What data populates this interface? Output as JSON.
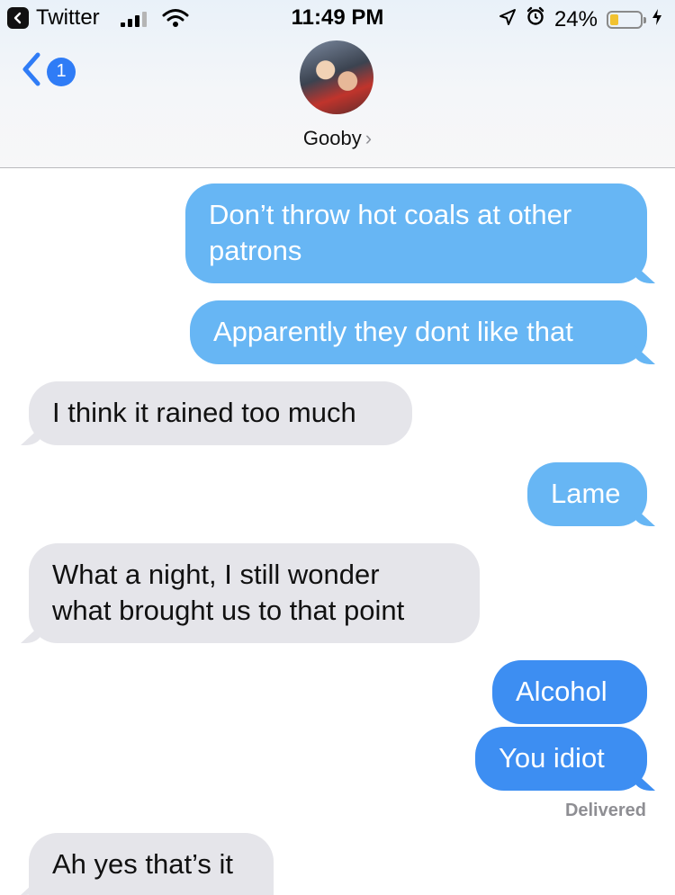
{
  "status_bar": {
    "back_app_label": "Twitter",
    "time": "11:49 PM",
    "battery_percent": "24%",
    "battery_level": 0.24,
    "battery_color": "#f2c230",
    "icons": [
      "signal-icon",
      "wifi-icon",
      "location-arrow-icon",
      "alarm-icon",
      "battery-icon",
      "charging-bolt-icon"
    ]
  },
  "header": {
    "back_badge_count": "1",
    "contact_name": "Gooby",
    "contact_chevron": "›"
  },
  "colors": {
    "sent_light": "#67b6f4",
    "sent_dark": "#3d8ef2",
    "received": "#e5e5ea",
    "accent": "#2f7cf6"
  },
  "messages": [
    {
      "direction": "sent",
      "text_lines": [
        "Don’t throw hot coals at other",
        "patrons"
      ]
    },
    {
      "direction": "sent",
      "text_lines": [
        "Apparently they dont like that"
      ]
    },
    {
      "direction": "received",
      "text_lines": [
        "I think it rained too much"
      ]
    },
    {
      "direction": "sent",
      "text_lines": [
        "Lame"
      ]
    },
    {
      "direction": "received",
      "text_lines": [
        "What a night, I still wonder",
        "what brought us to that point"
      ]
    },
    {
      "direction": "sent",
      "text_lines": [
        "Alcohol"
      ]
    },
    {
      "direction": "sent",
      "text_lines": [
        "You idiot"
      ]
    },
    {
      "direction": "received",
      "text_lines": [
        "Ah yes that’s it"
      ]
    }
  ],
  "delivered_label": "Delivered"
}
